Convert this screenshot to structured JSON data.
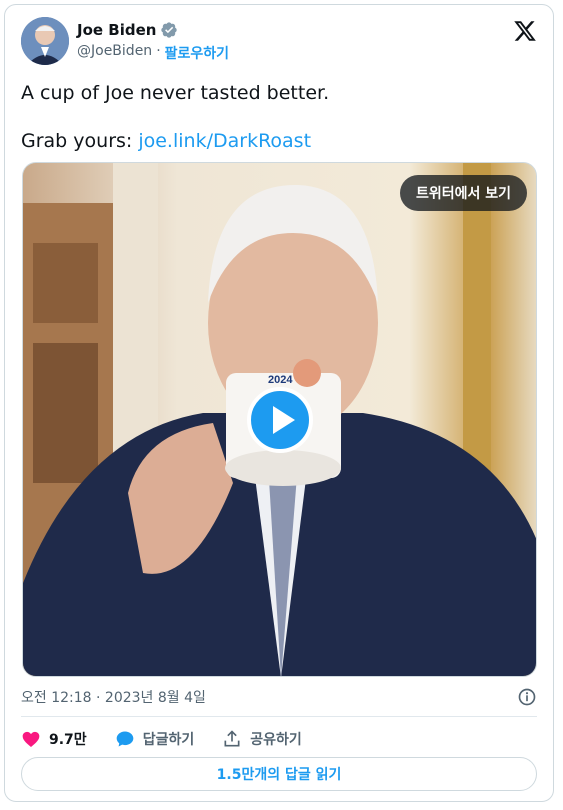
{
  "author": {
    "name": "Joe Biden",
    "handle": "@JoeBiden",
    "separator": "·",
    "follow_label": "팔로우하기"
  },
  "tweet": {
    "line1": "A cup of Joe never tasted better.",
    "line2_prefix": "Grab yours: ",
    "link_text": "joe.link/DarkRoast"
  },
  "media": {
    "watch_label": "트위터에서 보기",
    "mug_text": "2024"
  },
  "timestamp": "오전 12:18 · 2023년 8월 4일",
  "actions": {
    "likes_count": "9.7만",
    "reply_label": "답글하기",
    "share_label": "공유하기"
  },
  "replies_button": "1.5만개의 답글 읽기",
  "colors": {
    "accent": "#1d9bf0",
    "like": "#f91880",
    "muted": "#536471"
  }
}
